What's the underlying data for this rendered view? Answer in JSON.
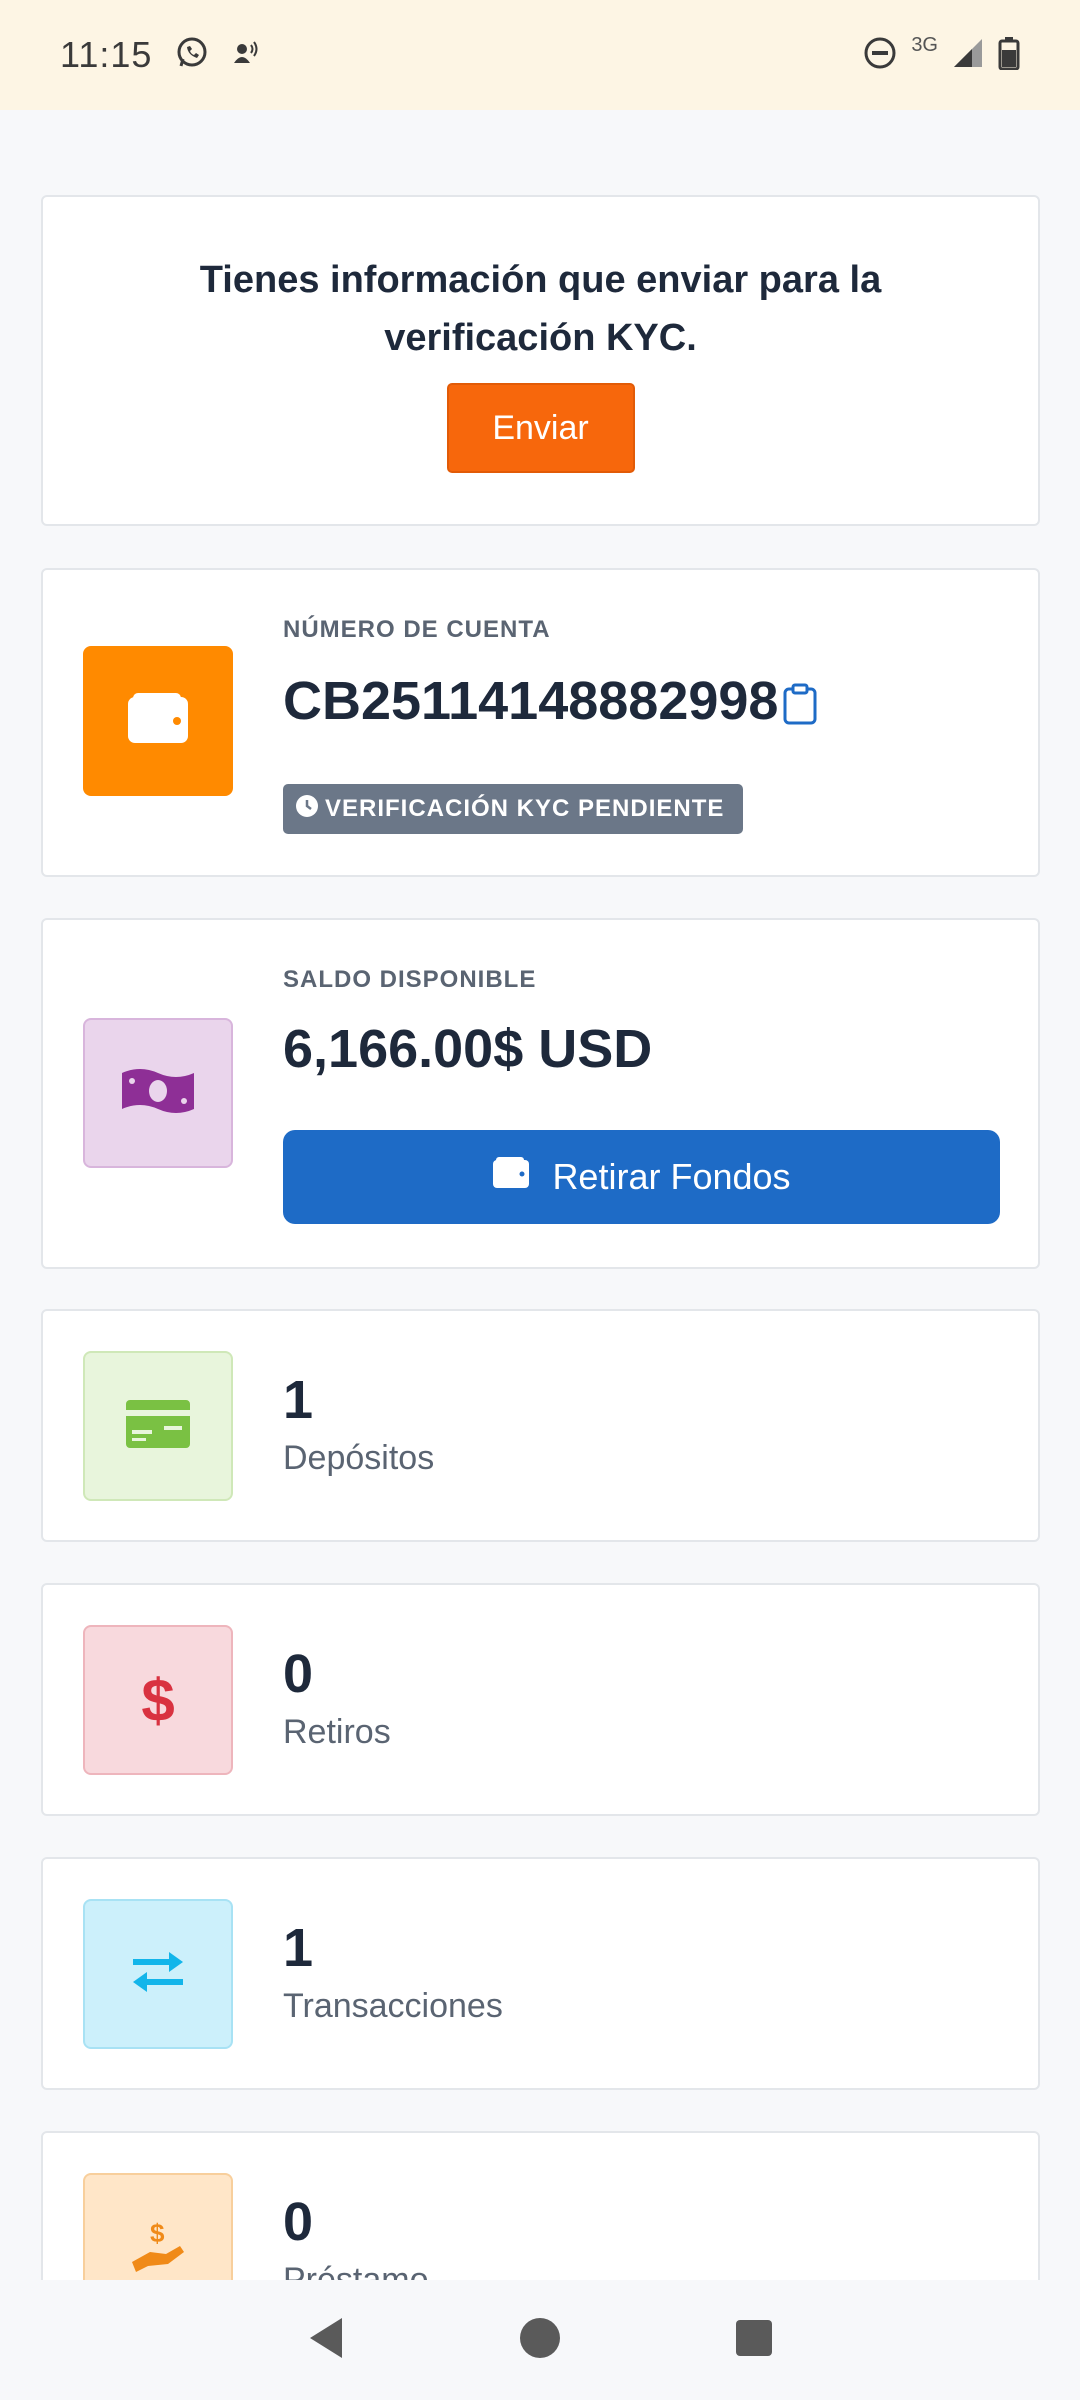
{
  "status_bar": {
    "time": "11:15",
    "network": "3G"
  },
  "kyc_notice": {
    "message": "Tienes información que enviar para la verificación KYC.",
    "button_label": "Enviar"
  },
  "account": {
    "label": "NÚMERO DE CUENTA",
    "number": "CB25114148882998",
    "badge": "VERIFICACIÓN KYC PENDIENTE",
    "icon": "wallet-icon",
    "icon_bg": "#ff8a00"
  },
  "balance": {
    "label": "SALDO DISPONIBLE",
    "amount": "6,166.00$ USD",
    "button_label": "Retirar Fondos",
    "icon": "banknote-icon",
    "icon_bg": "#ead5ec"
  },
  "stats": [
    {
      "value": "1",
      "label": "Depósitos",
      "icon": "credit-card-icon",
      "icon_bg": "#e8f5dc",
      "icon_color": "#7ac143"
    },
    {
      "value": "0",
      "label": "Retiros",
      "icon": "dollar-icon",
      "icon_bg": "#f8d9dd",
      "icon_color": "#d93240"
    },
    {
      "value": "1",
      "label": "Transacciones",
      "icon": "exchange-arrows-icon",
      "icon_bg": "#ccf0fb",
      "icon_color": "#12b5ea"
    },
    {
      "value": "0",
      "label": "Préstamo",
      "icon": "hand-dollar-icon",
      "icon_bg": "#ffe6c8",
      "icon_color": "#f08a18"
    }
  ],
  "colors": {
    "accent_orange": "#f7670c",
    "primary_blue": "#1e6bc6",
    "badge_gray": "#6b7788"
  }
}
